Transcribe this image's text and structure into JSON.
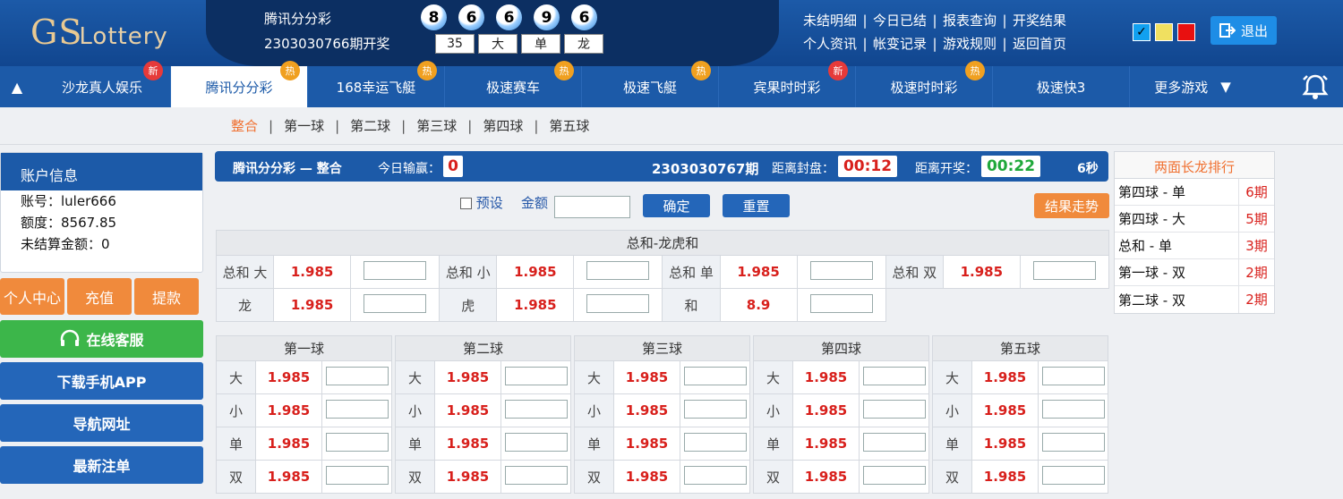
{
  "header": {
    "logo_main": "GS",
    "logo_sub": "Lottery",
    "game_name": "腾讯分分彩",
    "issue_text": "2303030766期开奖",
    "balls": [
      "8",
      "6",
      "6",
      "9",
      "6"
    ],
    "sums": [
      "35",
      "大",
      "单",
      "龙"
    ],
    "links_row1": [
      "未结明细",
      "今日已结",
      "报表查询",
      "开奖结果"
    ],
    "links_row2": [
      "个人资讯",
      "帐变记录",
      "游戏规则",
      "返回首页"
    ],
    "separator": "|",
    "color_options": [
      "#11a0f0",
      "#f0e060",
      "#e81010"
    ],
    "logout_label": "退出"
  },
  "nav": {
    "tabs": [
      {
        "label": "沙龙真人娱乐",
        "badge": "新",
        "badge_type": "new"
      },
      {
        "label": "腾讯分分彩",
        "badge": "热",
        "badge_type": "hot",
        "active": true
      },
      {
        "label": "168幸运飞艇",
        "badge": "热",
        "badge_type": "hot"
      },
      {
        "label": "极速赛车",
        "badge": "热",
        "badge_type": "hot"
      },
      {
        "label": "极速飞艇",
        "badge": "热",
        "badge_type": "hot"
      },
      {
        "label": "宾果时时彩",
        "badge": "新",
        "badge_type": "new"
      },
      {
        "label": "极速时时彩",
        "badge": "热",
        "badge_type": "hot"
      },
      {
        "label": "极速快3",
        "badge": "",
        "badge_type": ""
      }
    ],
    "more_label": "更多游戏"
  },
  "subtabs": [
    "整合",
    "第一球",
    "第二球",
    "第三球",
    "第四球",
    "第五球"
  ],
  "account": {
    "title": "账户信息",
    "account_line": "账号：luler666",
    "credit_line": "额度：8567.85",
    "unsettled_line": "未结算金额：0"
  },
  "sidebar_buttons": {
    "personal": "个人中心",
    "recharge": "充值",
    "withdraw": "提款",
    "service": "在线客服",
    "app": "下载手机APP",
    "nav_site": "导航网址",
    "latest": "最新注单"
  },
  "bar": {
    "title": "腾讯分分彩 — 整合",
    "today_label": "今日输赢：",
    "today_value": "0",
    "issue": "2303030767期",
    "close_label": "距离封盘：",
    "close_time": "00:12",
    "draw_label": "距离开奖：",
    "draw_time": "00:22",
    "seconds": "6秒"
  },
  "controls": {
    "preset_label": "预设",
    "amount_label": "金额",
    "confirm": "确定",
    "reset": "重置",
    "trend": "结果走势"
  },
  "sum_table": {
    "title": "总和-龙虎和",
    "row1": [
      {
        "label": "总和 大",
        "odds": "1.985"
      },
      {
        "label": "总和 小",
        "odds": "1.985"
      },
      {
        "label": "总和 单",
        "odds": "1.985"
      },
      {
        "label": "总和 双",
        "odds": "1.985"
      }
    ],
    "row2": [
      {
        "label": "龙",
        "odds": "1.985"
      },
      {
        "label": "虎",
        "odds": "1.985"
      },
      {
        "label": "和",
        "odds": "8.9"
      }
    ]
  },
  "balls_tables": [
    {
      "title": "第一球",
      "rows": [
        {
          "label": "大",
          "odds": "1.985"
        },
        {
          "label": "小",
          "odds": "1.985"
        },
        {
          "label": "单",
          "odds": "1.985"
        },
        {
          "label": "双",
          "odds": "1.985"
        }
      ]
    },
    {
      "title": "第二球",
      "rows": [
        {
          "label": "大",
          "odds": "1.985"
        },
        {
          "label": "小",
          "odds": "1.985"
        },
        {
          "label": "单",
          "odds": "1.985"
        },
        {
          "label": "双",
          "odds": "1.985"
        }
      ]
    },
    {
      "title": "第三球",
      "rows": [
        {
          "label": "大",
          "odds": "1.985"
        },
        {
          "label": "小",
          "odds": "1.985"
        },
        {
          "label": "单",
          "odds": "1.985"
        },
        {
          "label": "双",
          "odds": "1.985"
        }
      ]
    },
    {
      "title": "第四球",
      "rows": [
        {
          "label": "大",
          "odds": "1.985"
        },
        {
          "label": "小",
          "odds": "1.985"
        },
        {
          "label": "单",
          "odds": "1.985"
        },
        {
          "label": "双",
          "odds": "1.985"
        }
      ]
    },
    {
      "title": "第五球",
      "rows": [
        {
          "label": "大",
          "odds": "1.985"
        },
        {
          "label": "小",
          "odds": "1.985"
        },
        {
          "label": "单",
          "odds": "1.985"
        },
        {
          "label": "双",
          "odds": "1.985"
        }
      ]
    }
  ],
  "ranking": {
    "title": "两面长龙排行",
    "rows": [
      {
        "item": "第四球 - 单",
        "count": "6期"
      },
      {
        "item": "第四球 - 大",
        "count": "5期"
      },
      {
        "item": "总和 - 单",
        "count": "3期"
      },
      {
        "item": "第一球 - 双",
        "count": "2期"
      },
      {
        "item": "第二球 - 双",
        "count": "2期"
      }
    ]
  }
}
